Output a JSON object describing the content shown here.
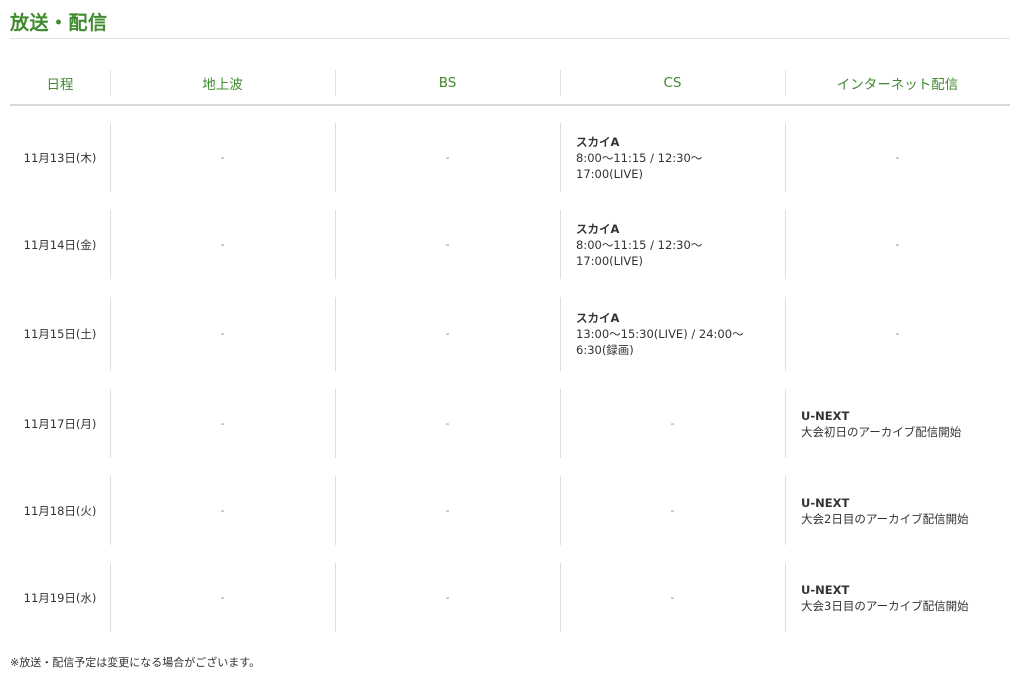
{
  "section": {
    "title": "放送・配信"
  },
  "table": {
    "headers": [
      "日程",
      "地上波",
      "BS",
      "CS",
      "インターネット配信"
    ],
    "rows": [
      {
        "date": "11月13日(木)",
        "terrestrial": "-",
        "bs": "-",
        "cs": {
          "name": "スカイA",
          "detail": "8:00〜11:15 / 12:30〜17:00(LIVE)"
        },
        "internet": {
          "name": "",
          "detail": "-"
        }
      },
      {
        "date": "11月14日(金)",
        "terrestrial": "-",
        "bs": "-",
        "cs": {
          "name": "スカイA",
          "detail": "8:00〜11:15 / 12:30〜17:00(LIVE)"
        },
        "internet": {
          "name": "",
          "detail": "-"
        }
      },
      {
        "date": "11月15日(土)",
        "terrestrial": "-",
        "bs": "-",
        "cs": {
          "name": "スカイA",
          "detail": "13:00〜15:30(LIVE) / 24:00〜6:30(録画)"
        },
        "internet": {
          "name": "",
          "detail": "-"
        }
      },
      {
        "date": "11月17日(月)",
        "terrestrial": "-",
        "bs": "-",
        "cs": {
          "name": "",
          "detail": "-"
        },
        "internet": {
          "name": "U-NEXT",
          "detail": "大会初日のアーカイブ配信開始"
        }
      },
      {
        "date": "11月18日(火)",
        "terrestrial": "-",
        "bs": "-",
        "cs": {
          "name": "",
          "detail": "-"
        },
        "internet": {
          "name": "U-NEXT",
          "detail": "大会2日目のアーカイブ配信開始"
        }
      },
      {
        "date": "11月19日(水)",
        "terrestrial": "-",
        "bs": "-",
        "cs": {
          "name": "",
          "detail": "-"
        },
        "internet": {
          "name": "U-NEXT",
          "detail": "大会3日目のアーカイブ配信開始"
        }
      }
    ]
  },
  "note": "※放送・配信予定は変更になる場合がございます。",
  "colors": {
    "accent": "#3f8a2e",
    "row_alt": "#f3f3f3",
    "text": "#333333"
  }
}
